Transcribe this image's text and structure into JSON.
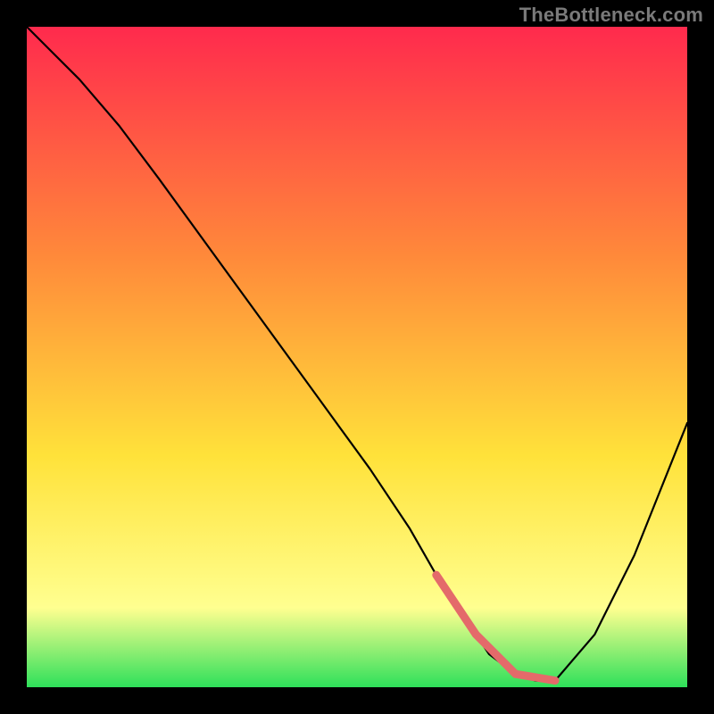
{
  "watermark": "TheBottleneck.com",
  "colors": {
    "gradient_top": "#ff2a4d",
    "gradient_mid1": "#ff8a3a",
    "gradient_mid2": "#ffe23a",
    "gradient_mid3": "#ffff90",
    "gradient_bottom": "#2ee05a",
    "curve": "#000000",
    "marker": "#e46a6a"
  },
  "chart_data": {
    "type": "line",
    "title": "",
    "xlabel": "",
    "ylabel": "",
    "xlim": [
      0,
      100
    ],
    "ylim": [
      0,
      100
    ],
    "x": [
      0,
      4,
      8,
      14,
      20,
      28,
      36,
      44,
      52,
      58,
      62,
      66,
      70,
      74,
      77,
      80,
      86,
      92,
      96,
      100
    ],
    "values": [
      100,
      96,
      92,
      85,
      77,
      66,
      55,
      44,
      33,
      24,
      17,
      11,
      5,
      2,
      1,
      1,
      8,
      20,
      30,
      40
    ],
    "marker_segment": {
      "x0": 62,
      "x1": 80
    }
  }
}
